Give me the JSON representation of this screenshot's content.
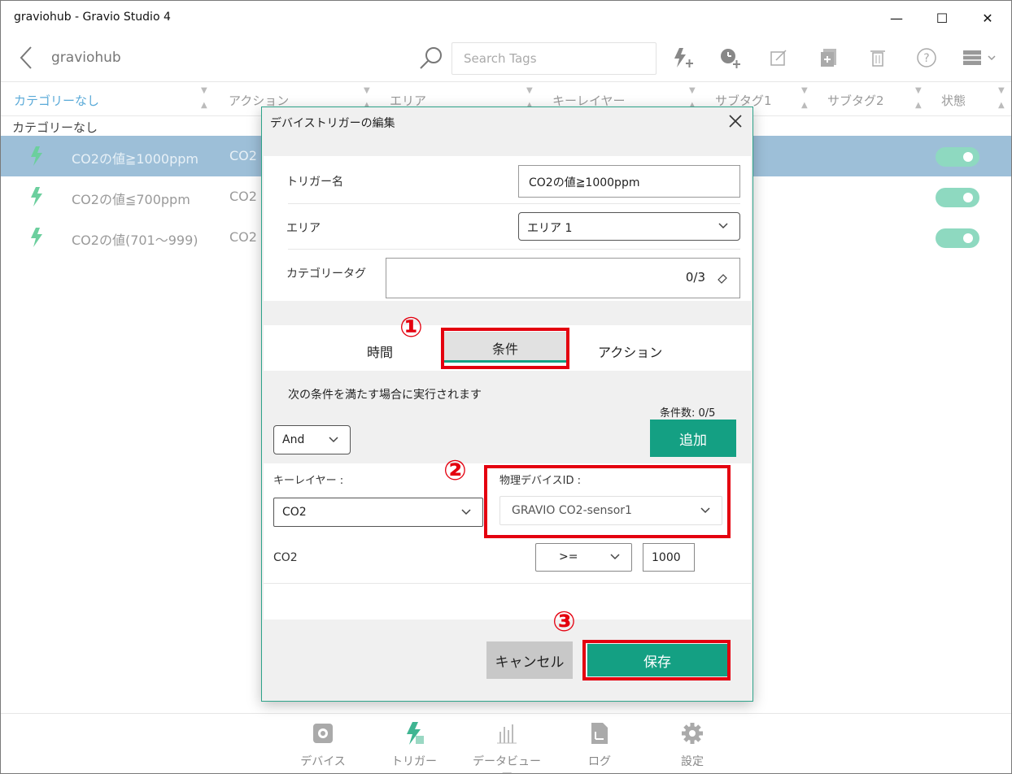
{
  "window": {
    "title": "graviohub - Gravio Studio 4",
    "minimize": "—",
    "maximize": "☐",
    "close": "✕"
  },
  "toolbar": {
    "breadcrumb": "graviohub",
    "search_placeholder": "Search Tags"
  },
  "table": {
    "headers": [
      "カテゴリーなし",
      "アクション",
      "エリア",
      "キーレイヤー",
      "サブタグ1",
      "サブタグ2",
      "状態"
    ],
    "group": "カテゴリーなし",
    "rows": [
      {
        "name": "CO2の値≧1000ppm",
        "action": "CO2",
        "enabled": true,
        "selected": true
      },
      {
        "name": "CO2の値≦700ppm",
        "action": "CO2",
        "enabled": true,
        "selected": false
      },
      {
        "name": "CO2の値(701～999)",
        "action": "CO2",
        "enabled": true,
        "selected": false
      }
    ]
  },
  "dialog": {
    "title": "デバイストリガーの編集",
    "trigger_name_label": "トリガー名",
    "trigger_name_value": "CO2の値≧1000ppm",
    "area_label": "エリア",
    "area_value": "エリア 1",
    "category_label": "カテゴリータグ",
    "category_count": "0/3",
    "tabs": [
      "時間",
      "条件",
      "アクション"
    ],
    "condition_desc": "次の条件を満たす場合に実行されます",
    "condition_count": "条件数: 0/5",
    "and_or_value": "And",
    "add_button": "追加",
    "key_layer_label": "キーレイヤー :",
    "key_layer_value": "CO2",
    "device_id_label": "物理デバイスID :",
    "device_id_value": "GRAVIO CO2-sensor1",
    "sensor_label": "CO2",
    "operator_value": ">=",
    "threshold_value": "1000",
    "cancel_button": "キャンセル",
    "save_button": "保存"
  },
  "annotations": [
    "①",
    "②",
    "③"
  ],
  "bottom_nav": [
    {
      "label": "デバイス",
      "icon": "device-icon"
    },
    {
      "label": "トリガー",
      "icon": "trigger-icon"
    },
    {
      "label": "データビューア",
      "icon": "chart-icon"
    },
    {
      "label": "ログ",
      "icon": "log-icon"
    },
    {
      "label": "設定",
      "icon": "settings-icon"
    }
  ],
  "colors": {
    "accent": "#14a083",
    "highlight": "#e4000f",
    "selected_row": "#9dbfd8",
    "header_active": "#5aaad8",
    "toggle_on": "#8ed9c0"
  }
}
